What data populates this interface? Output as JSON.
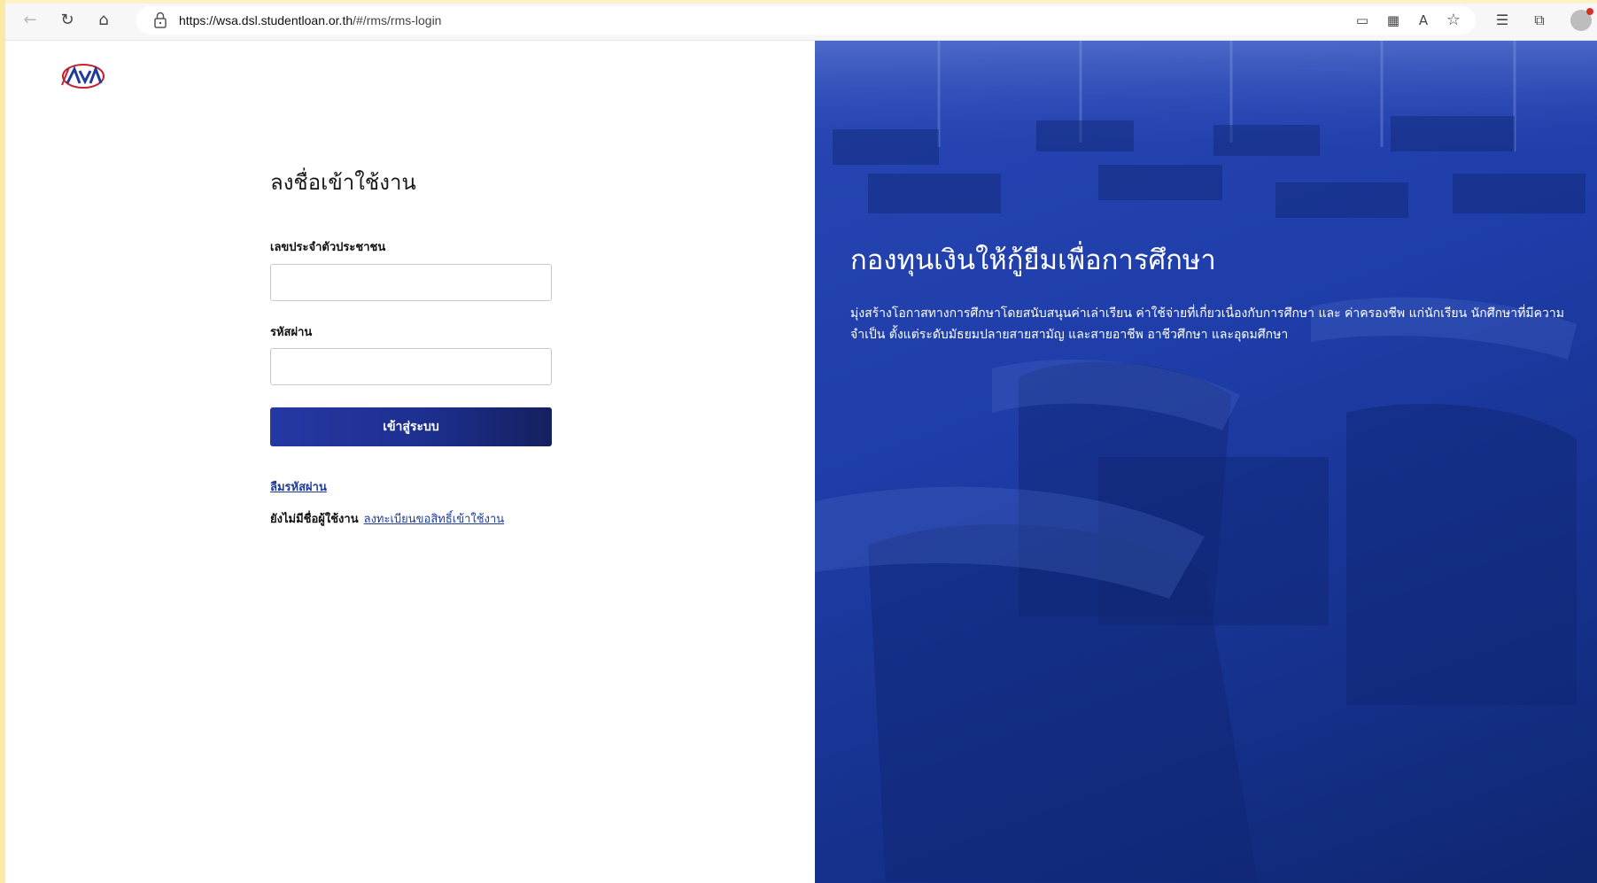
{
  "browser": {
    "url_host": "https://wsa.dsl.studentloan.or.th",
    "url_path": "/#/rms/rms-login"
  },
  "login": {
    "title": "ลงชื่อเข้าใช้งาน",
    "id_label": "เลขประจำตัวประชาชน",
    "id_value": "",
    "password_label": "รหัสผ่าน",
    "password_value": "",
    "submit_label": "เข้าสู่ระบบ",
    "forgot_label": "ลืมรหัสผ่าน",
    "no_account_text": "ยังไม่มีชื่อผู้ใช้งาน",
    "register_label": "ลงทะเบียนขอสิทธิ์เข้าใช้งาน"
  },
  "hero": {
    "title": "กองทุนเงินให้กู้ยืมเพื่อการศึกษา",
    "description": "มุ่งสร้างโอกาสทางการศึกษาโดยสนับสนุนค่าเล่าเรียน ค่าใช้จ่ายที่เกี่ยวเนื่องกับการศึกษา และ ค่าครองชีพ แก่นักเรียน นักศึกษาที่มีความจำเป็น ตั้งแต่ระดับมัธยมปลายสายสามัญ และสายอาชีพ อาชีวศึกษา และอุดมศึกษา"
  },
  "icons": {
    "back": "back-arrow-icon",
    "refresh": "refresh-icon",
    "home": "home-icon",
    "lock": "lock-icon",
    "toolbar": [
      "screen-cast-icon",
      "qr-code-icon",
      "read-aloud-icon",
      "favorite-add-icon",
      "favorites-icon",
      "collections-icon"
    ]
  },
  "colors": {
    "brand_blue": "#1d2f8f",
    "hero_blue": "#1e3da8",
    "link": "#1f3c9b"
  }
}
